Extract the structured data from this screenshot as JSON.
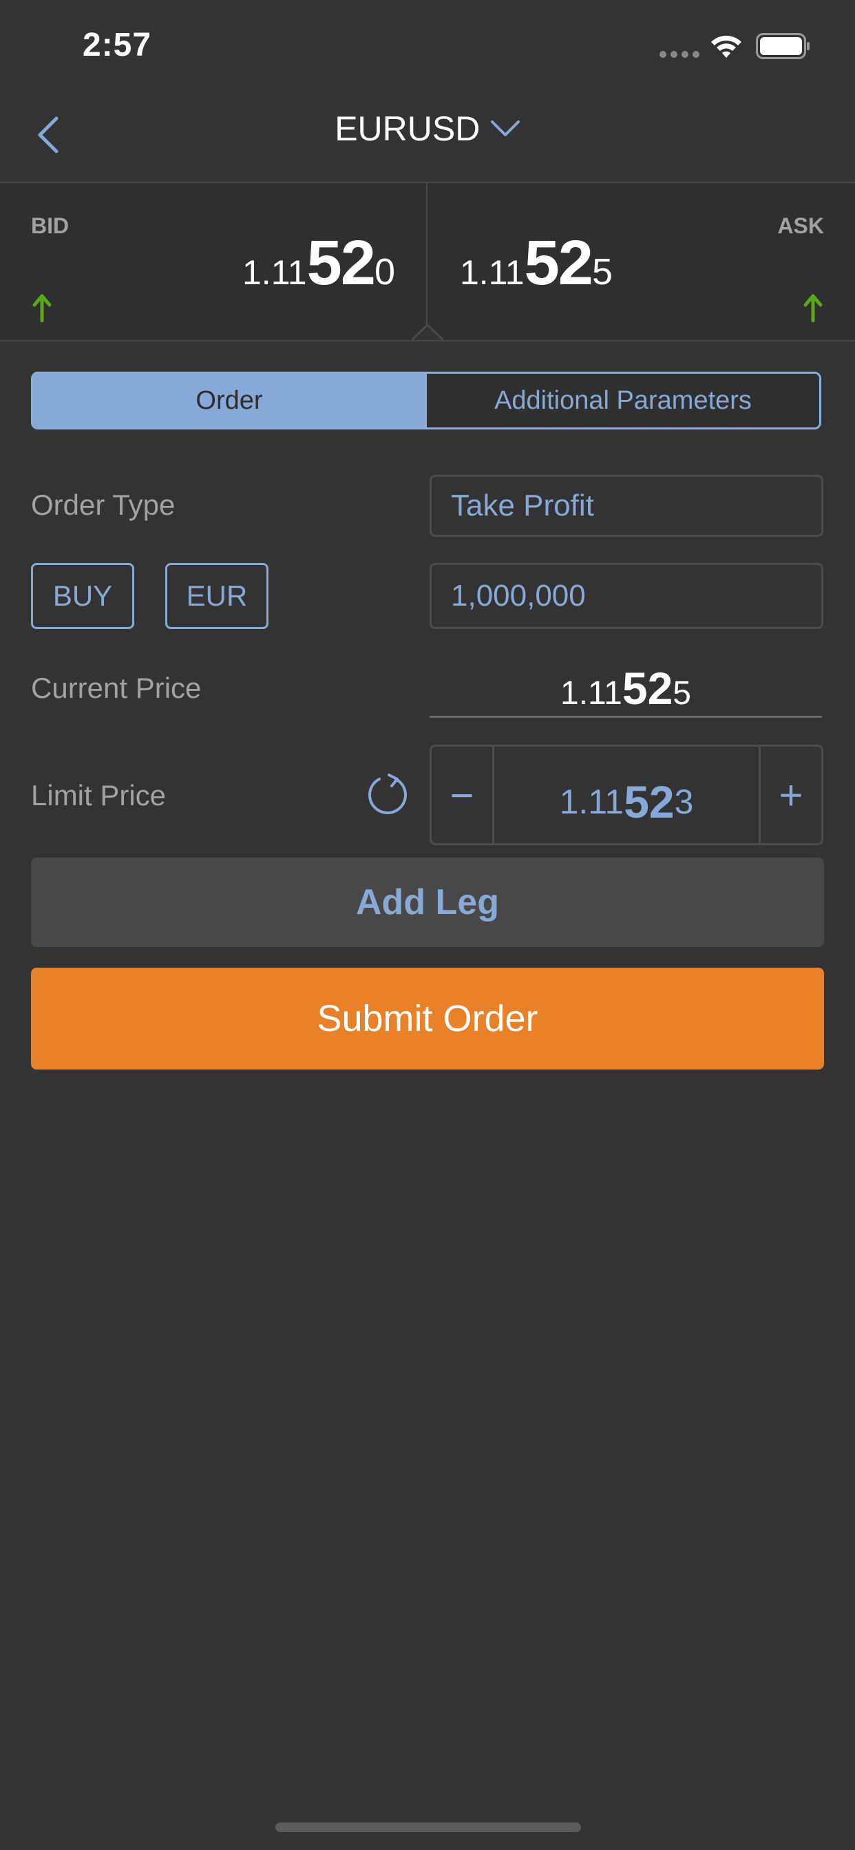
{
  "status_bar": {
    "time": "2:57"
  },
  "nav": {
    "title": "EURUSD"
  },
  "quotes": {
    "bid": {
      "label": "BID",
      "prefix": "1.11",
      "big": "52",
      "last": "0"
    },
    "ask": {
      "label": "ASK",
      "prefix": "1.11",
      "big": "52",
      "last": "5"
    }
  },
  "tabs": [
    {
      "label": "Order",
      "active": true
    },
    {
      "label": "Additional Parameters",
      "active": false
    }
  ],
  "form": {
    "order_type_label": "Order Type",
    "order_type_value": "Take Profit",
    "side_label": "BUY",
    "currency_label": "EUR",
    "quantity_value": "1,000,000",
    "current_price_label": "Current Price",
    "current_price": {
      "prefix": "1.11",
      "big": "52",
      "last": "5"
    },
    "limit_price_label": "Limit Price",
    "limit_price": {
      "prefix": "1.11",
      "big": "52",
      "last": "3"
    },
    "minus_symbol": "−",
    "plus_symbol": "+"
  },
  "actions": {
    "add_leg_label": "Add Leg",
    "submit_label": "Submit Order"
  },
  "colors": {
    "background": "#333333",
    "accent": "#87a9d8",
    "submit": "#e88127",
    "up_arrow": "#5aa91a"
  }
}
